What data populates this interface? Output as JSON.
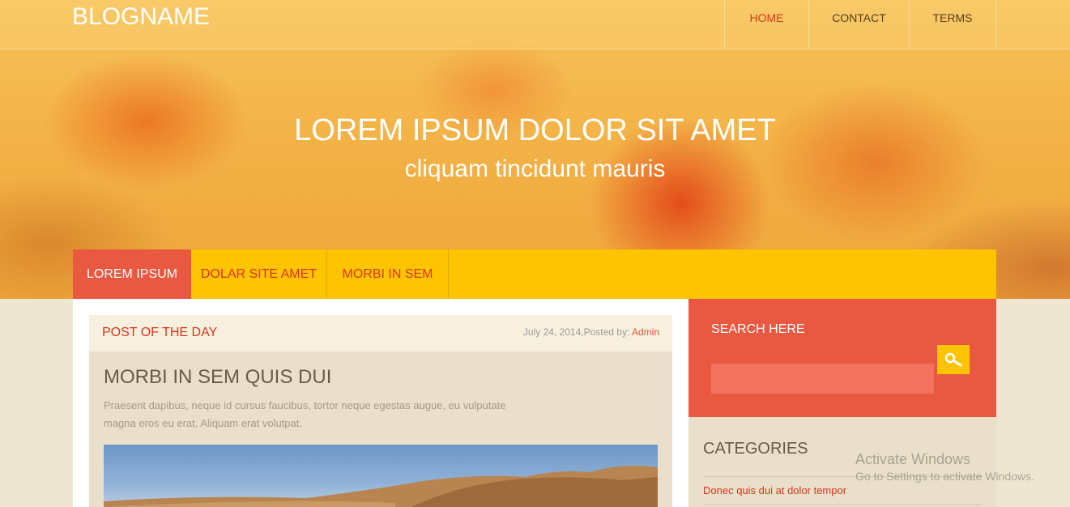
{
  "header": {
    "brand": "BLOGNAME",
    "nav": [
      {
        "label": "HOME",
        "active": true
      },
      {
        "label": "CONTACT",
        "active": false
      },
      {
        "label": "TERMS",
        "active": false
      }
    ]
  },
  "hero": {
    "title": "LOREM IPSUM DOLOR SIT AMET",
    "subtitle": "cliquam tincidunt mauris"
  },
  "tabs": [
    {
      "label": "LOREM IPSUM",
      "active": true
    },
    {
      "label": "DOLAR SITE AMET",
      "active": false
    },
    {
      "label": "MORBI IN SEM",
      "active": false
    }
  ],
  "post": {
    "section_label": "POST OF THE DAY",
    "date": "July 24, 2014,",
    "posted_by_label": "Posted by: ",
    "author": "Admin",
    "title": "MORBI IN SEM QUIS DUI",
    "excerpt_line1": "Praesent dapibus, neque id cursus faucibus, tortor neque egestas augue, eu vulputate",
    "excerpt_line2": "magna eros eu erat. Aliquam erat volutpat."
  },
  "sidebar": {
    "search_title": "SEARCH HERE",
    "search_value": "",
    "categories_title": "CATEGORIES",
    "categories": [
      "Donec quis dui at dolor tempor"
    ]
  },
  "watermark": {
    "title": "Activate Windows",
    "subtitle": "Go to Settings to activate Windows."
  },
  "colors": {
    "accent_red": "#e95840",
    "accent_yellow": "#ffc400",
    "text_red": "#d9361c"
  }
}
